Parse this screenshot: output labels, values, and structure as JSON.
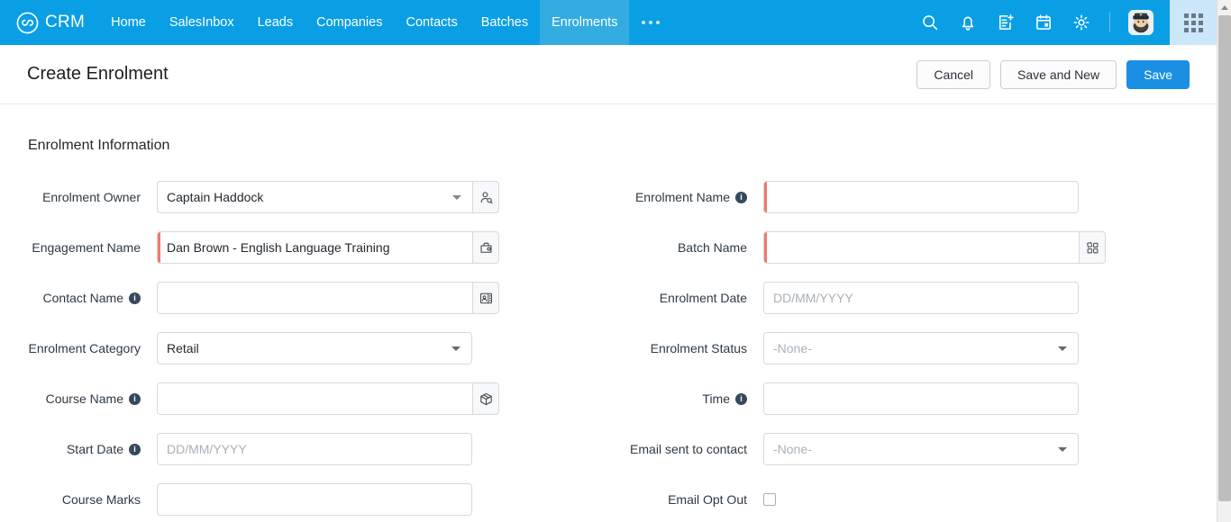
{
  "nav": {
    "logo_icon": "zoho-loop-logo-icon",
    "brand": "CRM",
    "items": [
      {
        "label": "Home",
        "active": false
      },
      {
        "label": "SalesInbox",
        "active": false
      },
      {
        "label": "Leads",
        "active": false
      },
      {
        "label": "Companies",
        "active": false
      },
      {
        "label": "Contacts",
        "active": false
      },
      {
        "label": "Batches",
        "active": false
      },
      {
        "label": "Enrolments",
        "active": true
      }
    ],
    "more_label": "...",
    "icons": [
      "search-icon",
      "bell-icon",
      "note-add-icon",
      "calendar-icon",
      "gear-icon"
    ],
    "avatar_name": "user-avatar",
    "app_switcher": "app-grid-icon",
    "bar_color": "#0a9fe5",
    "active_tab_color": "#34ace0"
  },
  "header": {
    "title": "Create Enrolment",
    "cancel_label": "Cancel",
    "save_new_label": "Save and New",
    "save_label": "Save",
    "primary_color": "#1a8fe3"
  },
  "form": {
    "section_title": "Enrolment Information",
    "required_marker_color": "#f4766a",
    "left_fields": [
      {
        "label": "Enrolment Owner",
        "info": false,
        "required": false,
        "type": "lookup-select",
        "value": "Captain Haddock",
        "placeholder": "",
        "caret": true,
        "lookup_icon": "user-search-icon"
      },
      {
        "label": "Engagement Name",
        "info": false,
        "required": true,
        "type": "lookup",
        "value": "Dan Brown - English Language Training",
        "placeholder": "",
        "caret": false,
        "lookup_icon": "engagement-briefcase-icon"
      },
      {
        "label": "Contact Name",
        "info": true,
        "required": false,
        "type": "lookup",
        "value": "",
        "placeholder": "",
        "caret": false,
        "lookup_icon": "contact-card-icon"
      },
      {
        "label": "Enrolment Category",
        "info": false,
        "required": false,
        "type": "select",
        "value": "Retail",
        "placeholder": "",
        "caret": true,
        "lookup_icon": ""
      },
      {
        "label": "Course Name",
        "info": true,
        "required": false,
        "type": "lookup",
        "value": "",
        "placeholder": "",
        "caret": false,
        "lookup_icon": "package-box-icon"
      },
      {
        "label": "Start Date",
        "info": true,
        "required": false,
        "type": "text",
        "value": "",
        "placeholder": "DD/MM/YYYY",
        "caret": false,
        "lookup_icon": ""
      },
      {
        "label": "Course Marks",
        "info": false,
        "required": false,
        "type": "text",
        "value": "",
        "placeholder": "",
        "caret": false,
        "lookup_icon": ""
      }
    ],
    "right_fields": [
      {
        "label": "Enrolment Name",
        "info": true,
        "required": true,
        "type": "text",
        "value": "",
        "placeholder": "",
        "caret": false,
        "lookup_icon": ""
      },
      {
        "label": "Batch Name",
        "info": false,
        "required": true,
        "type": "lookup",
        "value": "",
        "placeholder": "",
        "caret": false,
        "lookup_icon": "batch-grid-icon"
      },
      {
        "label": "Enrolment Date",
        "info": false,
        "required": false,
        "type": "text",
        "value": "",
        "placeholder": "DD/MM/YYYY",
        "caret": false,
        "lookup_icon": ""
      },
      {
        "label": "Enrolment Status",
        "info": false,
        "required": false,
        "type": "select",
        "value": "",
        "placeholder": "-None-",
        "caret": true,
        "lookup_icon": ""
      },
      {
        "label": "Time",
        "info": true,
        "required": false,
        "type": "text",
        "value": "",
        "placeholder": "",
        "caret": false,
        "lookup_icon": ""
      },
      {
        "label": "Email sent to contact",
        "info": false,
        "required": false,
        "type": "select",
        "value": "",
        "placeholder": "-None-",
        "caret": true,
        "lookup_icon": ""
      },
      {
        "label": "Email Opt Out",
        "info": false,
        "required": false,
        "type": "checkbox",
        "value": "",
        "placeholder": "",
        "caret": false,
        "lookup_icon": "",
        "checked": false
      }
    ]
  },
  "scrollbar": {
    "up_arrow": "scroll-up-arrow-icon"
  }
}
